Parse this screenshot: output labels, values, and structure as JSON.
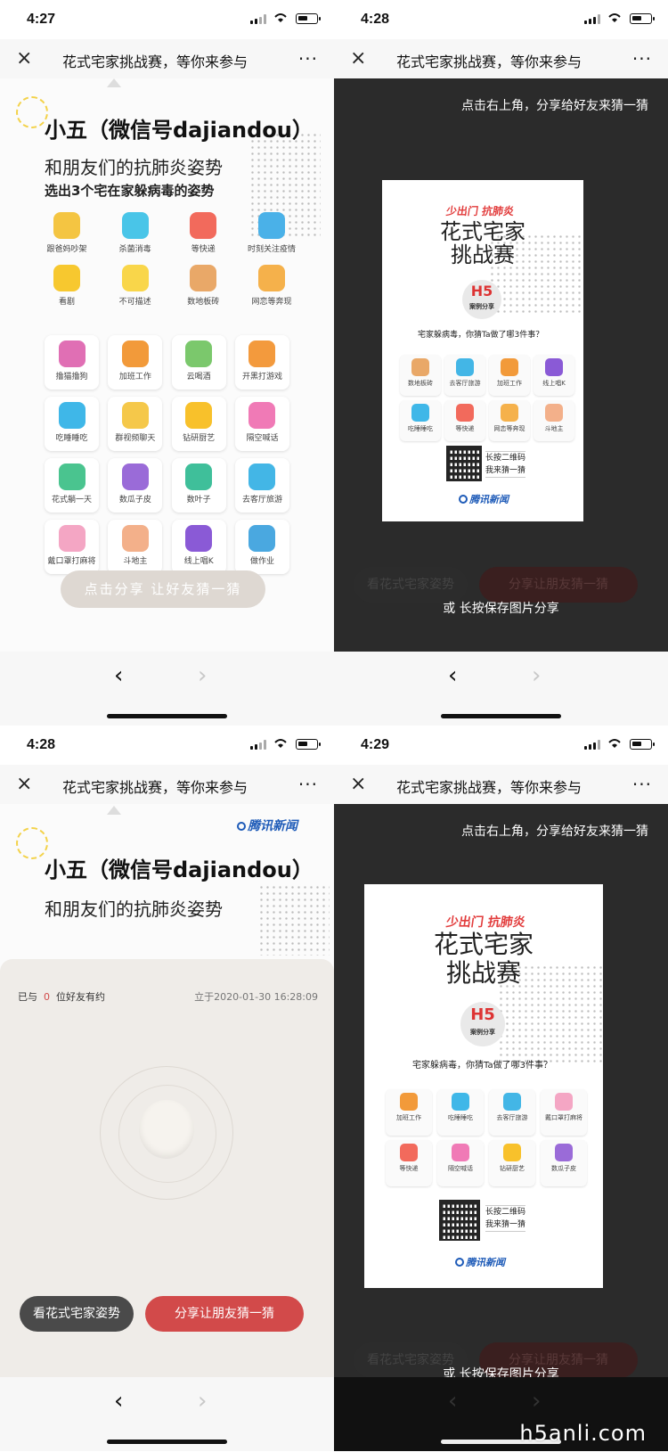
{
  "colors": {
    "accent_red": "#d24a4a",
    "dark_button": "#4a4a4a",
    "overlay": "#141414",
    "tencent_blue": "#1e5bb8"
  },
  "common": {
    "page_title": "花式宅家挑战赛，等你来参与",
    "close_icon": "×",
    "more_icon": "···",
    "back_icon": "‹",
    "forward_icon": "›"
  },
  "screens": [
    {
      "time": "4:27"
    },
    {
      "time": "4:28"
    },
    {
      "time": "4:28"
    },
    {
      "time": "4:29"
    }
  ],
  "main": {
    "name": "小五（微信号dajiandou）",
    "subtitle": "和朋友们的抗肺炎姿势",
    "instruction": "选出3个宅在家躲病毒的姿势",
    "top_icons": [
      [
        "跟爸妈吵架",
        "杀菌消毒",
        "等快递",
        "时刻关注疫情"
      ],
      [
        "看剧",
        "不可描述",
        "数地板砖",
        "网恋等奔现"
      ]
    ],
    "cards": [
      [
        "撸猫撸狗",
        "加班工作",
        "云喝酒",
        "开黑打游戏"
      ],
      [
        "吃睡睡吃",
        "群视频聊天",
        "钻研厨艺",
        "隔空喊话"
      ],
      [
        "花式躺一天",
        "数瓜子皮",
        "数叶子",
        "去客厅旅游"
      ],
      [
        "戴口罩打麻将",
        "斗地主",
        "线上唱K",
        "做作业"
      ]
    ],
    "share_button": "点击分享 让好友猜一猜"
  },
  "overlay": {
    "tip_top": "点击右上角，分享给好友来猜一猜",
    "tip_bottom": "或 长按保存图片分享",
    "behind_buttons": [
      "看花式宅家姿势",
      "分享让朋友猜一猜"
    ]
  },
  "poster1": {
    "tag": "少出门  抗肺炎",
    "title_line1": "花式宅家",
    "title_line2": "挑战赛",
    "badge_main": "H5",
    "badge_sub": "案例分享",
    "question": "宅家躲病毒，你猜Ta做了哪3件事？",
    "items": [
      "数地板砖",
      "去客厅旅游",
      "加班工作",
      "线上唱K",
      "吃睡睡吃",
      "等快递",
      "网恋等奔现",
      "斗地主"
    ],
    "qr_line1": "长按二维码",
    "qr_line2": "我来猜一猜",
    "brand": "腾讯新闻"
  },
  "result": {
    "brand": "腾讯新闻",
    "name": "小五（微信号dajiandou）",
    "subtitle": "和朋友们的抗肺炎姿势",
    "meta_prefix": "已与",
    "meta_count": "0",
    "meta_suffix": "位好友有约",
    "meta_time": "立于2020-01-30 16:28:09",
    "btn_view": "看花式宅家姿势",
    "btn_share": "分享让朋友猜一猜"
  },
  "poster2": {
    "tag": "少出门  抗肺炎",
    "title_line1": "花式宅家",
    "title_line2": "挑战赛",
    "badge_main": "H5",
    "badge_sub": "案例分享",
    "question": "宅家躲病毒，你猜Ta做了哪3件事？",
    "items": [
      "加班工作",
      "吃睡睡吃",
      "去客厅旅游",
      "戴口罩打麻将",
      "等快递",
      "隔空喊话",
      "钻研厨艺",
      "数瓜子皮"
    ],
    "qr_line1": "长按二维码",
    "qr_line2": "我来猜一猜",
    "brand": "腾讯新闻"
  },
  "watermark": "h5anli.com"
}
